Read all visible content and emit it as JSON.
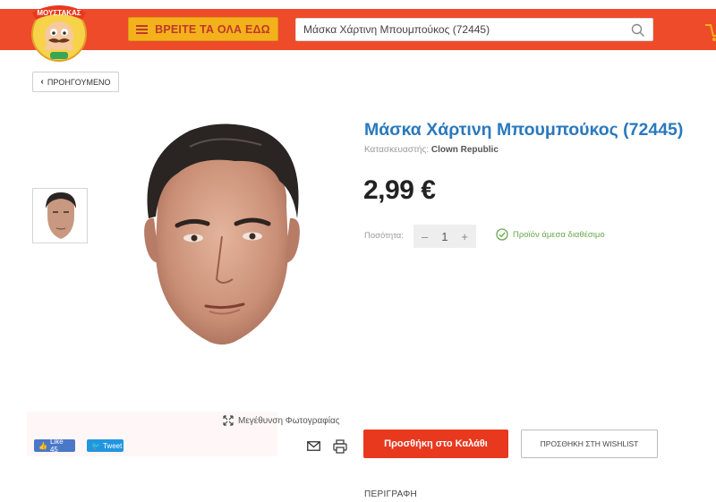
{
  "header": {
    "logo_text": "ΜΟΥΣΤΑΚΑΣ",
    "menu_button_label": "ΒΡΕΙΤΕ ΤΑ ΟΛΑ ΕΔΩ",
    "search_value": "Μάσκα Χάρτινη Μπουμπούκος (72445)"
  },
  "nav": {
    "back_label": "ΠΡΟΗΓΟΥΜΕΝΟ"
  },
  "gallery": {
    "zoom_label": "Μεγέθυνση Φωτογραφίας"
  },
  "social": {
    "like_label": "Like 45",
    "tweet_label": "Tweet"
  },
  "product": {
    "title": "Μάσκα Χάρτινη Μπουμπούκος (72445)",
    "manufacturer_label": "Κατασκευαστής:",
    "manufacturer": "Clown Republic",
    "price": "2,99 €",
    "quantity_label": "Ποσότητα:",
    "quantity": "1",
    "minus": "–",
    "plus": "+",
    "stock_status": "Προϊόν άμεσα διαθέσιμο",
    "add_to_cart": "Προσθήκη στο Καλάθι",
    "wishlist": "ΠΡΟΣΘΗΚΗ ΣΤΗ WISHLIST",
    "description_tab": "ΠΕΡΙΓΡΑΦΗ"
  },
  "colors": {
    "brand_red": "#ee4b2b",
    "menu_yellow": "#f3b11c",
    "title_blue": "#2a79bd",
    "stock_green": "#6aa84f",
    "cart_button": "#e8391f"
  }
}
